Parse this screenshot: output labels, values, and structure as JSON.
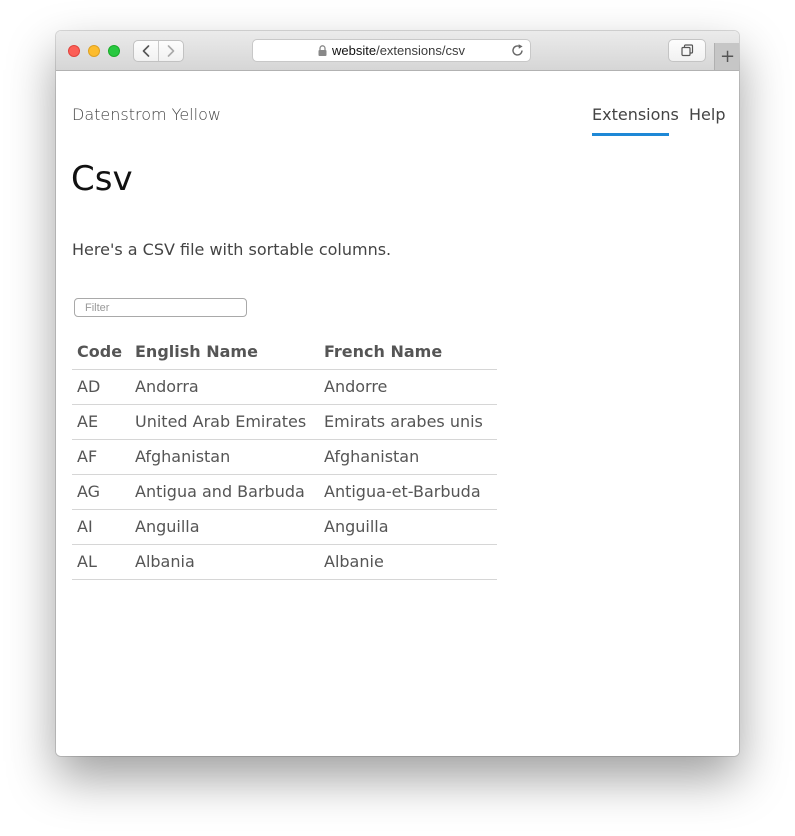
{
  "browser": {
    "url_domain": "website",
    "url_path": "/extensions/csv"
  },
  "site": {
    "title": "Datenstrom Yellow",
    "nav": [
      {
        "label": "Extensions",
        "active": true
      },
      {
        "label": "Help",
        "active": false
      }
    ],
    "accent_color": "#1e88d6"
  },
  "page": {
    "title": "Csv",
    "intro": "Here's a CSV file with sortable columns.",
    "filter_placeholder": "Filter"
  },
  "table": {
    "headers": [
      "Code",
      "English Name",
      "French Name"
    ],
    "rows": [
      [
        "AD",
        "Andorra",
        "Andorre"
      ],
      [
        "AE",
        "United Arab Emirates",
        "Emirats arabes unis"
      ],
      [
        "AF",
        "Afghanistan",
        "Afghanistan"
      ],
      [
        "AG",
        "Antigua and Barbuda",
        "Antigua-et-Barbuda"
      ],
      [
        "AI",
        "Anguilla",
        "Anguilla"
      ],
      [
        "AL",
        "Albania",
        "Albanie"
      ]
    ]
  },
  "icons": {
    "traffic_lights": [
      "close-button-red",
      "minimize-button-yellow",
      "maximize-button-green"
    ],
    "nav": [
      "chevron-left-icon",
      "chevron-right-icon"
    ],
    "url": [
      "lock-icon",
      "reload-icon"
    ],
    "toolbar": [
      "tabs-overview-icon",
      "plus-icon"
    ]
  }
}
